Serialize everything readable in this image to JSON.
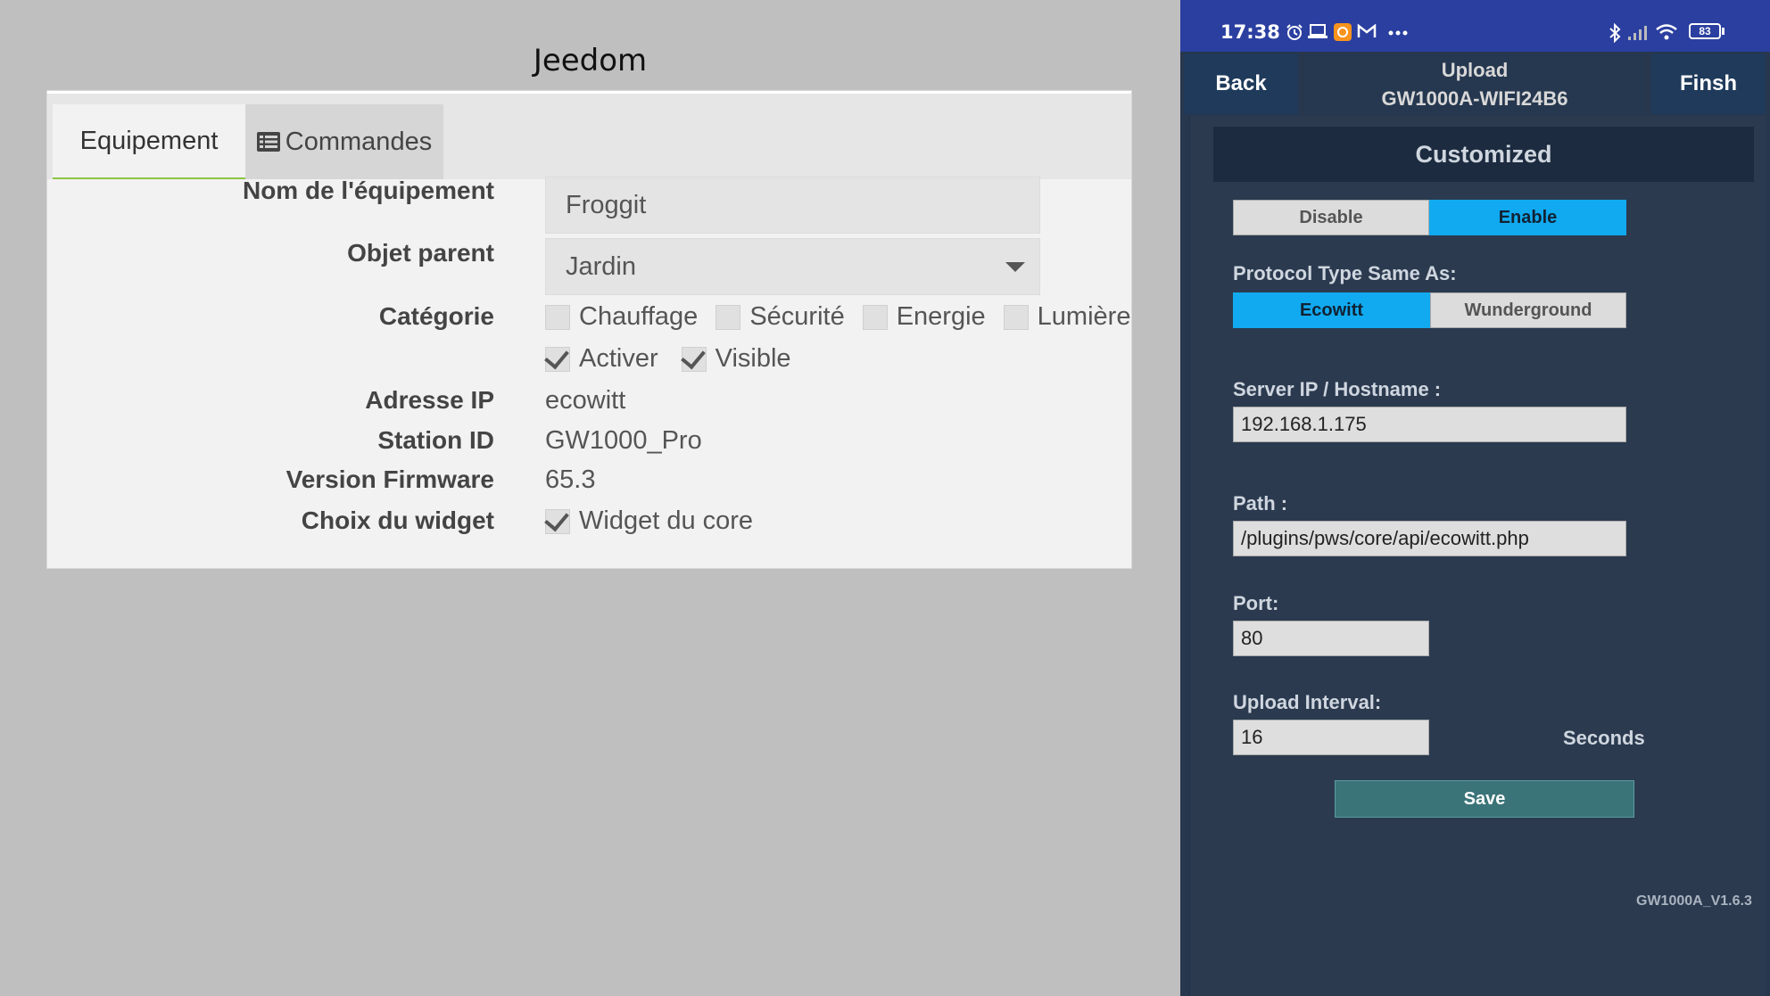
{
  "jeedom": {
    "title": "Jeedom",
    "tabs": {
      "equipement": "Equipement",
      "commandes": "Commandes"
    },
    "form": {
      "nom_label": "Nom de l'équipement",
      "nom_value": "Froggit",
      "objet_label": "Objet parent",
      "objet_value": "Jardin",
      "categorie_label": "Catégorie",
      "categories": [
        "Chauffage",
        "Sécurité",
        "Energie",
        "Lumière"
      ],
      "activer": "Activer",
      "visible": "Visible",
      "ip_label": "Adresse IP",
      "ip_value": "ecowitt",
      "station_label": "Station ID",
      "station_value": "GW1000_Pro",
      "firmware_label": "Version Firmware",
      "firmware_value": "65.3",
      "widget_label": "Choix du widget",
      "widget_value": "Widget du core"
    }
  },
  "phone": {
    "status": {
      "time": "17:38",
      "battery": "83"
    },
    "appbar": {
      "back": "Back",
      "title_line1": "Upload",
      "title_line2": "GW1000A-WIFI24B6",
      "finish": "Finsh"
    },
    "section": "Customized",
    "toggle": {
      "disable": "Disable",
      "enable": "Enable",
      "selected": "Enable"
    },
    "protocol_label": "Protocol Type Same As:",
    "protocol": {
      "ecowitt": "Ecowitt",
      "wunderground": "Wunderground",
      "selected": "Ecowitt"
    },
    "server_label": "Server IP / Hostname :",
    "server_value": "192.168.1.175",
    "path_label": "Path :",
    "path_value": "/plugins/pws/core/api/ecowitt.php",
    "port_label": "Port:",
    "port_value": "80",
    "interval_label": "Upload Interval:",
    "interval_value": "16",
    "seconds": "Seconds",
    "save": "Save",
    "version": "GW1000A_V1.6.3"
  },
  "colors": {
    "accent_blue": "#11aaf0",
    "tab_underline": "#8cc63f",
    "statusbar": "#2a3fa0",
    "phone_bg": "#27374e"
  }
}
